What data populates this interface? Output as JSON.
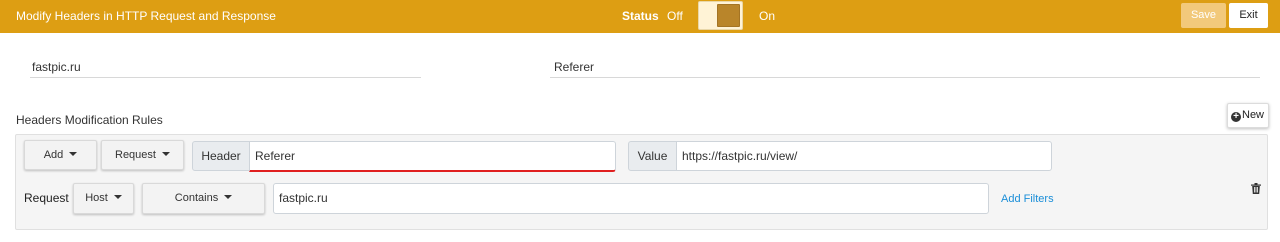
{
  "header": {
    "title": "Modify Headers in HTTP Request and Response",
    "status_label": "Status",
    "status_off": "Off",
    "status_on": "On",
    "save_label": "Save",
    "exit_label": "Exit"
  },
  "profile": {
    "domain_value": "fastpic.ru",
    "header_value": "Referer"
  },
  "rules_section": {
    "title": "Headers Modification Rules",
    "new_label": "New"
  },
  "rule": {
    "action_label": "Add",
    "type_label": "Request",
    "header_addon": "Header",
    "header_value": "Referer",
    "value_addon": "Value",
    "value_value": "https://fastpic.ru/view/",
    "request_label": "Request",
    "filter_field_label": "Host",
    "filter_op_label": "Contains",
    "filter_value": "fastpic.ru",
    "add_filters_label": "Add Filters"
  },
  "colors": {
    "topbar": "#dd9e13",
    "save_button": "#f2c97b",
    "link": "#1a8ed8",
    "error_underline": "#e02020"
  },
  "icons": [
    "plus-circle-icon",
    "caret-down-icon",
    "trash-icon"
  ]
}
